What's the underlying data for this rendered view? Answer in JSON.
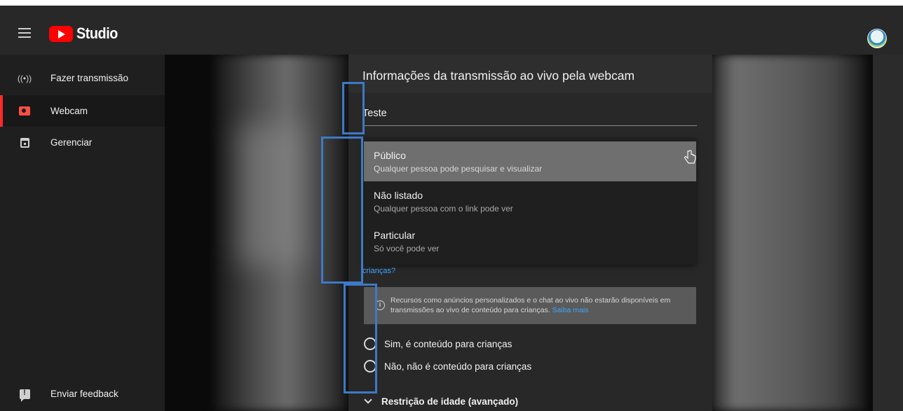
{
  "app": {
    "logo_text": "Studio"
  },
  "sidebar": {
    "items": [
      {
        "label": "Fazer transmissão",
        "icon": "broadcast-icon"
      },
      {
        "label": "Webcam",
        "icon": "camera-icon",
        "active": true
      },
      {
        "label": "Gerenciar",
        "icon": "calendar-icon"
      }
    ],
    "feedback": {
      "label": "Enviar feedback",
      "icon": "feedback-icon"
    }
  },
  "dialog": {
    "title": "Informações da transmissão ao vivo pela webcam",
    "title_field_value": "Teste",
    "visibility_options": [
      {
        "title": "Público",
        "subtitle": "Qualquer pessoa pode pesquisar e visualizar",
        "hovered": true
      },
      {
        "title": "Não listado",
        "subtitle": "Qualquer pessoa com o link pode ver"
      },
      {
        "title": "Particular",
        "subtitle": "Só você pode ver"
      }
    ],
    "kids_link": "crianças?",
    "info": {
      "text": "Recursos como anúncios personalizados e o chat ao vivo não estarão disponíveis em transmissões ao vivo de conteúdo para crianças.",
      "link": "Saiba mais"
    },
    "audience_options": [
      {
        "label": "Sim, é conteúdo para crianças"
      },
      {
        "label": "Não, não é conteúdo para crianças"
      }
    ],
    "age_restriction_label": "Restrição de idade (avançado)"
  },
  "colors": {
    "topbar": "#282828",
    "sidebar": "#1f1f1f",
    "brand_red": "#ff0000",
    "active_indicator": "#ff2b2b",
    "link": "#3ea6ff",
    "annotation_box": "#3d79c7"
  }
}
